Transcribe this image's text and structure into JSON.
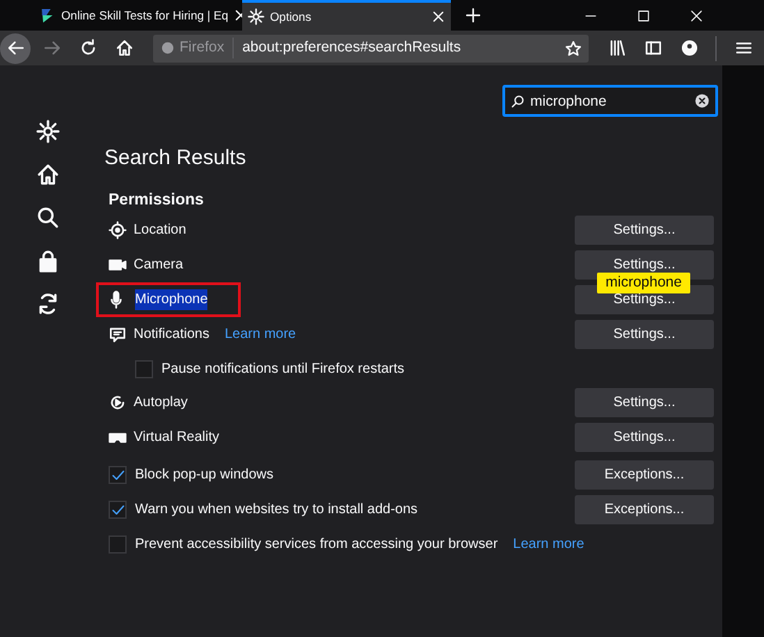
{
  "tabs": [
    {
      "title": "Online Skill Tests for Hiring | Eq",
      "selected": false
    },
    {
      "title": "Options",
      "selected": true
    }
  ],
  "address_bar": {
    "identity": "Firefox",
    "url": "about:preferences#searchResults"
  },
  "search": {
    "value": "microphone"
  },
  "heading": "Search Results",
  "section": "Permissions",
  "permissions": [
    {
      "label": "Location",
      "button": "Settings...",
      "highlighted": false,
      "boxed": false
    },
    {
      "label": "Camera",
      "button": "Settings...",
      "highlighted": false,
      "boxed": false
    },
    {
      "label": "Microphone",
      "button": "Settings...",
      "highlighted": true,
      "boxed": true,
      "tooltip": "microphone"
    },
    {
      "label": "Notifications",
      "button": "Settings...",
      "highlighted": false,
      "boxed": false,
      "learn_more": "Learn more",
      "sub_option": {
        "label": "Pause notifications until Firefox restarts",
        "checked": false
      }
    },
    {
      "label": "Autoplay",
      "button": "Settings...",
      "highlighted": false,
      "boxed": false
    },
    {
      "label": "Virtual Reality",
      "button": "Settings...",
      "highlighted": false,
      "boxed": false
    }
  ],
  "checkboxes": [
    {
      "label": "Block pop-up windows",
      "checked": true,
      "button": "Exceptions..."
    },
    {
      "label": "Warn you when websites try to install add-ons",
      "checked": true,
      "button": "Exceptions..."
    },
    {
      "label": "Prevent accessibility services from accessing your browser",
      "checked": false,
      "learn_more": "Learn more"
    }
  ]
}
